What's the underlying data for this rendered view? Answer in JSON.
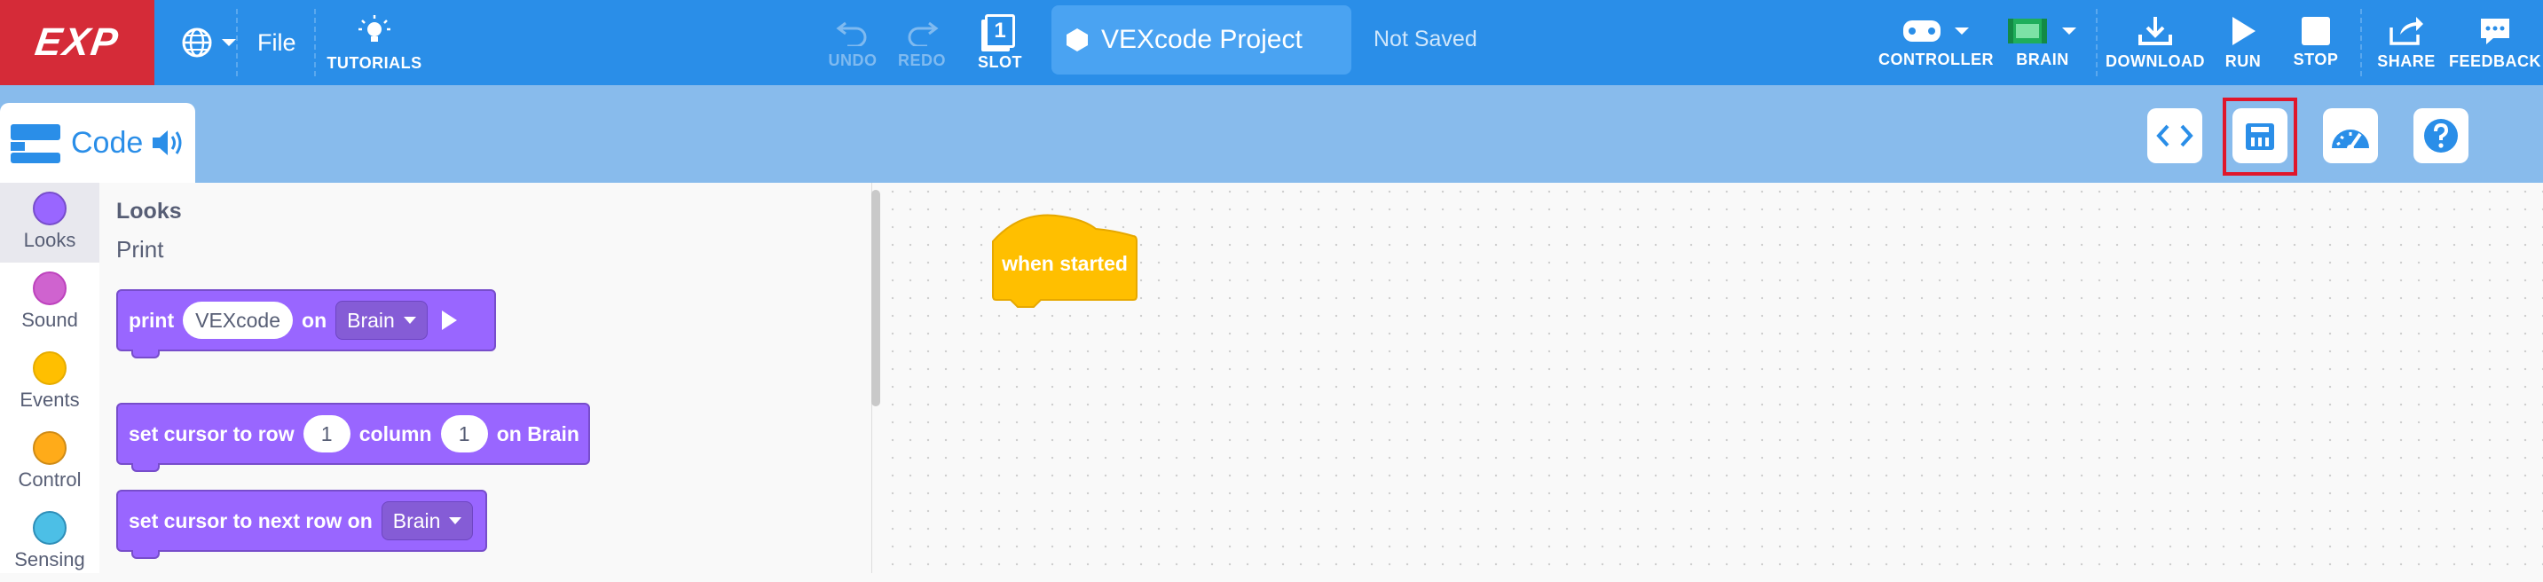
{
  "brand": {
    "logo_text": "EXP",
    "accent": "#2a8ee8",
    "logo_bg": "#d52b38"
  },
  "toolbar": {
    "file_label": "File",
    "tutorials_label": "TUTORIALS",
    "undo_label": "UNDO",
    "redo_label": "REDO",
    "slot_label": "SLOT",
    "slot_number": "1",
    "project_title": "VEXcode Project",
    "save_status": "Not Saved",
    "controller_label": "CONTROLLER",
    "brain_label": "BRAIN",
    "download_label": "DOWNLOAD",
    "run_label": "RUN",
    "stop_label": "STOP",
    "share_label": "SHARE",
    "feedback_label": "FEEDBACK"
  },
  "code_tab": {
    "label": "Code"
  },
  "right_buttons": [
    "code-view-icon",
    "devices-icon",
    "dashboard-icon",
    "help-icon"
  ],
  "categories": [
    {
      "name": "Looks",
      "color": "#9966ff",
      "selected": true
    },
    {
      "name": "Sound",
      "color": "#cf63cf",
      "selected": false
    },
    {
      "name": "Events",
      "color": "#ffbf00",
      "selected": false
    },
    {
      "name": "Control",
      "color": "#ffab19",
      "selected": false
    },
    {
      "name": "Sensing",
      "color": "#4cbfe6",
      "selected": false
    }
  ],
  "palette": {
    "section_title": "Looks",
    "subsection": "Print",
    "print_block": {
      "t1": "print",
      "value": "VEXcode",
      "t2": "on",
      "dropdown": "Brain"
    },
    "cursor_row_block": {
      "t1": "set cursor to row",
      "row": "1",
      "t2": "column",
      "col": "1",
      "t3": "on Brain"
    },
    "next_row_block": {
      "t1": "set cursor to next row on",
      "dropdown": "Brain"
    }
  },
  "workspace": {
    "hat_block_label": "when started"
  }
}
